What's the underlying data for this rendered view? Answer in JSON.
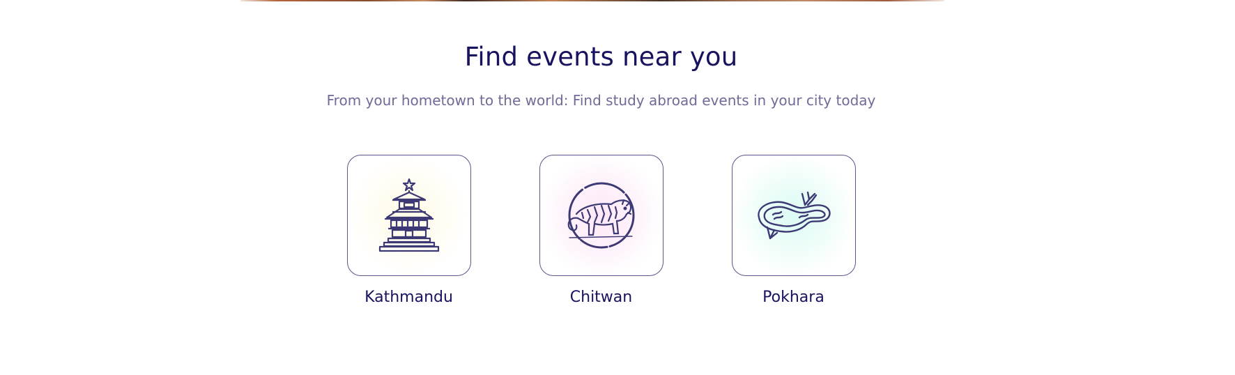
{
  "section": {
    "title": "Find events near you",
    "subtitle": "From your hometown to the world: Find study abroad events in your city today"
  },
  "cities": [
    {
      "name": "Kathmandu",
      "icon": "temple-icon",
      "tint": "#fffbe6"
    },
    {
      "name": "Chitwan",
      "icon": "tiger-icon",
      "tint": "#fde8f7"
    },
    {
      "name": "Pokhara",
      "icon": "lake-icon",
      "tint": "#dcfbf3"
    }
  ],
  "colors": {
    "heading": "#17135e",
    "subtitle": "#6f6a97",
    "tile_border": "#5a568f"
  }
}
